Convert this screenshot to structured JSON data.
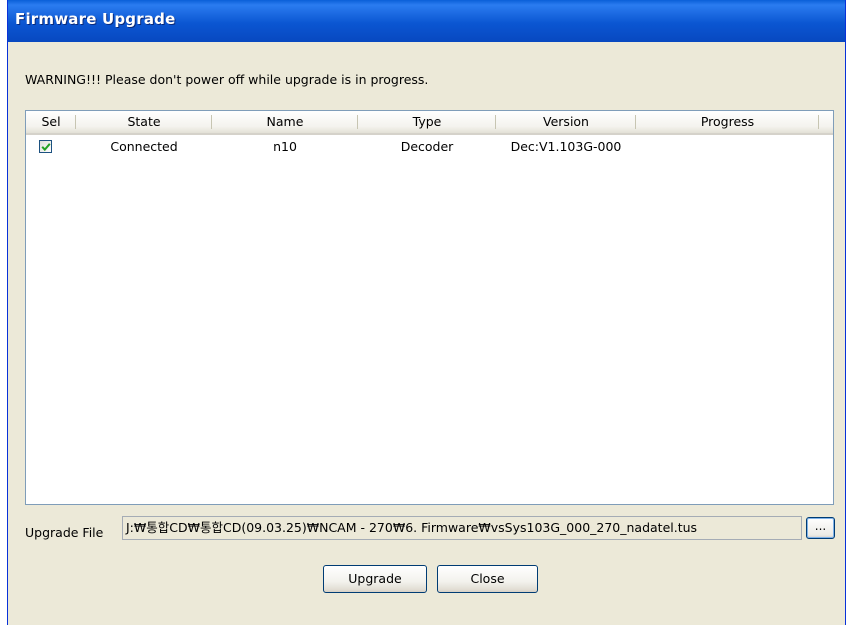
{
  "window": {
    "title": "Firmware Upgrade"
  },
  "warning_text": "WARNING!!!  Please don't power off while upgrade is in progress.",
  "device_list": {
    "columns": [
      "Sel",
      "State",
      "Name",
      "Type",
      "Version",
      "Progress"
    ],
    "rows": [
      {
        "selected": true,
        "state": "Connected",
        "name": "n10",
        "type": "Decoder",
        "version": "Dec:V1.103G-000",
        "progress": ""
      }
    ]
  },
  "upgrade_file": {
    "label": "Upgrade File",
    "value": "J:₩통합CD₩통합CD(09.03.25)₩NCAM - 270₩6. Firmware₩vsSys103G_000_270_nadatel.tus",
    "browse_label": "..."
  },
  "buttons": {
    "upgrade_label": "Upgrade",
    "close_label": "Close"
  }
}
